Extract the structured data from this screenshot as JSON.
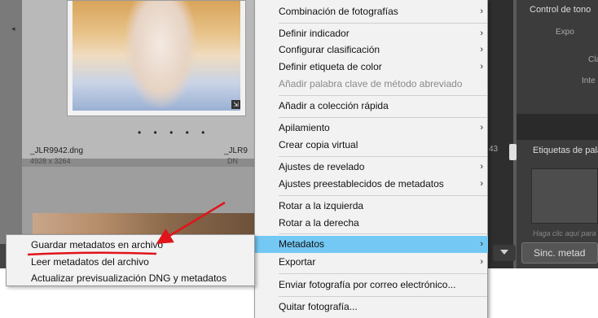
{
  "grid": {
    "file1_name": "_JLR9942.dng",
    "file1_dims": "4928 x 3264",
    "file2_name": "_JLR9",
    "file2_dims": "DN",
    "badge_glyph": "⇲",
    "dots": "• • • • •",
    "partial_number": "43"
  },
  "context_menu": {
    "items": [
      {
        "label": "Combinación de fotografías",
        "arrow": "›"
      },
      {
        "label": "Definir indicador",
        "arrow": "›"
      },
      {
        "label": "Configurar clasificación",
        "arrow": "›"
      },
      {
        "label": "Definir etiqueta de color",
        "arrow": "›"
      },
      {
        "label": "Añadir palabra clave de método abreviado",
        "arrow": ""
      },
      {
        "label": "Añadir a colección rápida",
        "arrow": ""
      },
      {
        "label": "Apilamiento",
        "arrow": "›"
      },
      {
        "label": "Crear copia virtual",
        "arrow": ""
      },
      {
        "label": "Ajustes de revelado",
        "arrow": "›"
      },
      {
        "label": "Ajustes preestablecidos de metadatos",
        "arrow": "›"
      },
      {
        "label": "Rotar a la izquierda",
        "arrow": ""
      },
      {
        "label": "Rotar a la derecha",
        "arrow": ""
      },
      {
        "label": "Metadatos",
        "arrow": "›"
      },
      {
        "label": "Exportar",
        "arrow": "›"
      },
      {
        "label": "Enviar fotografía por correo electrónico...",
        "arrow": ""
      },
      {
        "label": "Quitar fotografía...",
        "arrow": ""
      }
    ]
  },
  "submenu": {
    "items": [
      {
        "label": "Guardar metadatos en archivo"
      },
      {
        "label": "Leer metadatos del archivo"
      },
      {
        "label": "Actualizar previsualización DNG y metadatos"
      }
    ]
  },
  "right_panel": {
    "tone_title": "Control de tono",
    "line1": "Expo",
    "line2": "Cla",
    "line3": "Inte",
    "keywords_title": "Etiquetas de pala",
    "hint": "Haga clic aquí para",
    "sync_button": "Sinc. metad"
  },
  "colors": {
    "highlight": "#74c8f4",
    "annotation": "#e0141a"
  }
}
